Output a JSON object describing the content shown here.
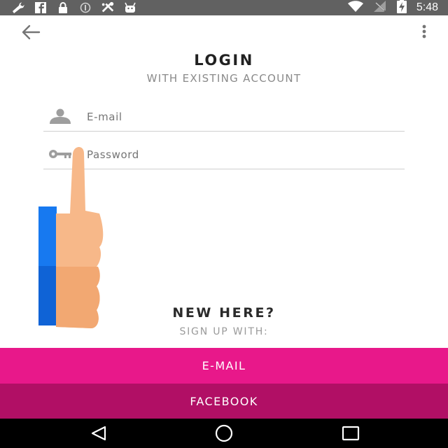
{
  "status_bar": {
    "time": "5:48",
    "left_icons": [
      "wrench-icon",
      "facebook-icon",
      "lock-icon",
      "sync-icon",
      "tools-icon",
      "android-icon"
    ],
    "right_icons": [
      "wifi-icon",
      "no-signal-icon",
      "battery-charging-icon"
    ]
  },
  "app_bar": {
    "back_icon": "arrow-left-icon",
    "menu_icon": "more-vert-icon"
  },
  "login": {
    "title": "LOGIN",
    "subtitle": "WITH EXISTING ACCOUNT",
    "email_placeholder": "E-mail",
    "password_placeholder": "Password"
  },
  "signup": {
    "title": "NEW HERE?",
    "subtitle": "SIGN UP WITH:",
    "email_button": "E-MAIL",
    "facebook_button": "FACEBOOK"
  },
  "nav_bar": {
    "icons": [
      "nav-back-icon",
      "nav-home-icon",
      "nav-recents-icon"
    ]
  },
  "colors": {
    "status_bar": "#616161",
    "email_button": "#e8188a",
    "facebook_button": "#b10f65",
    "overlay_blue": "#1779f0",
    "hand_skin": "#f7b889"
  }
}
